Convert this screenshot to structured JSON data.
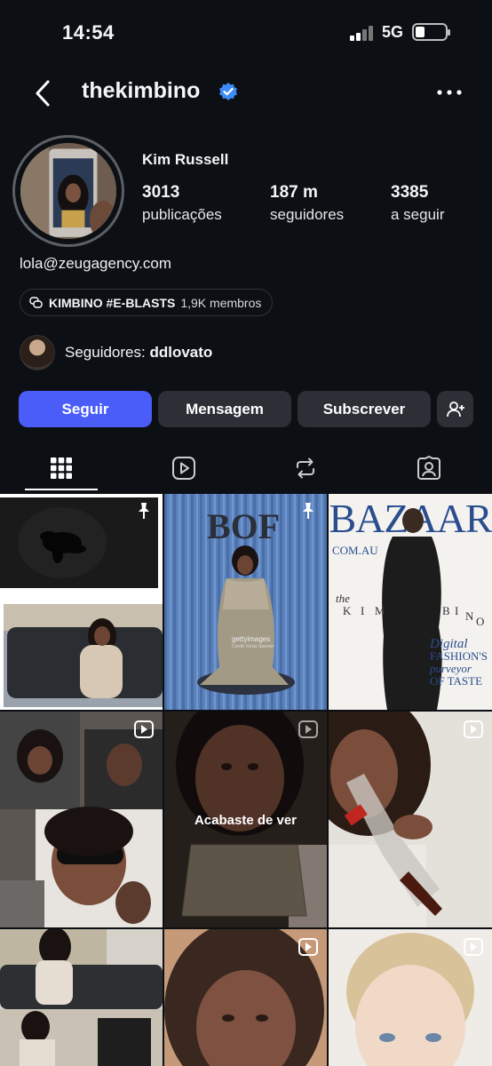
{
  "status_bar": {
    "time": "14:54",
    "network": "5G"
  },
  "header": {
    "username": "thekimbino",
    "back_icon": "chevron-left-icon",
    "more_icon": "ellipsis-icon"
  },
  "profile": {
    "name": "Kim Russell",
    "stats": [
      {
        "value": "3013",
        "label": "publicações"
      },
      {
        "value": "187 m",
        "label": "seguidores"
      },
      {
        "value": "3385",
        "label": "a seguir"
      }
    ],
    "email": "lola@zeugagency.com",
    "channel": {
      "name": "KIMBINO #E-BLASTS",
      "members": "1,9K membros"
    },
    "followed_by": {
      "prefix": "Seguidores: ",
      "user": "ddlovato"
    }
  },
  "actions": {
    "follow": "Seguir",
    "message": "Mensagem",
    "subscribe": "Subscrever",
    "add_user_icon": "add-person-icon"
  },
  "tabs": [
    {
      "icon": "grid-icon",
      "active": true
    },
    {
      "icon": "reels-icon",
      "active": false
    },
    {
      "icon": "reposts-icon",
      "active": false
    },
    {
      "icon": "tagged-icon",
      "active": false
    }
  ],
  "grid": {
    "bof_title": "BOF",
    "getty_caption": "gettyimages",
    "getty_credit": "Credit: Kristy Sparow",
    "bazaar": {
      "brand": "BAZAAR",
      "domain": "COM.AU",
      "tagline": [
        "Digital",
        "FASHION'S",
        "purveyor",
        "OF TASTE"
      ],
      "letters": [
        "the",
        "K",
        "I",
        "M",
        "B",
        "I",
        "N",
        "O"
      ]
    },
    "watched_label": "Acabaste de ver"
  }
}
